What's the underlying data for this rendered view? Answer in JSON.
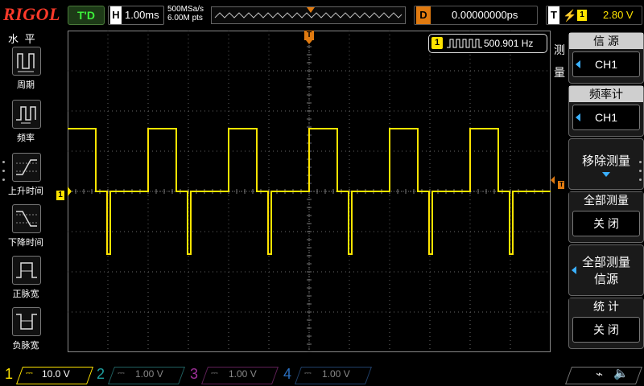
{
  "brand": "RIGOL",
  "top": {
    "trigger_status": "T'D",
    "horizontal_label": "H",
    "timebase": "1.00ms",
    "sample_rate": "500MSa/s",
    "memory_depth": "6.00M pts",
    "delay_label": "D",
    "delay_value": "0.00000000ps",
    "trigger_label": "T",
    "trigger_slope_icon": "rising-edge-icon",
    "trigger_source": "1",
    "trigger_level": "2.80 V"
  },
  "left_toolbar": {
    "title": "水 平",
    "items": [
      {
        "label": "周期",
        "icon": "period-icon"
      },
      {
        "label": "频率",
        "icon": "frequency-icon"
      },
      {
        "label": "上升时间",
        "icon": "rise-time-icon"
      },
      {
        "label": "下降时间",
        "icon": "fall-time-icon"
      },
      {
        "label": "正脉宽",
        "icon": "positive-width-icon"
      },
      {
        "label": "负脉宽",
        "icon": "negative-width-icon"
      }
    ]
  },
  "measurement": {
    "channel": "1",
    "icon": "square-wave-icon",
    "value": "500.901 Hz"
  },
  "right_menu": {
    "side_label_1": "测",
    "side_label_2": "量",
    "source_title": "信 源",
    "source_value": "CH1",
    "freq_counter_title": "频率计",
    "freq_counter_value": "CH1",
    "remove_measure": "移除测量",
    "all_measure_title": "全部测量",
    "all_measure_value": "关 闭",
    "all_measure_source_line1": "全部测量",
    "all_measure_source_line2": "信源",
    "stats_title": "统 计",
    "stats_value": "关 闭"
  },
  "markers": {
    "ch1_ground": "1",
    "trigger_pos": "T"
  },
  "bottom": {
    "channels": [
      {
        "num": "1",
        "scale": "10.0 V",
        "color": "#ffe400",
        "active": true
      },
      {
        "num": "2",
        "scale": "1.00 V",
        "color": "#1fa0a0",
        "active": false
      },
      {
        "num": "3",
        "scale": "1.00 V",
        "color": "#a0309a",
        "active": false
      },
      {
        "num": "4",
        "scale": "1.00 V",
        "color": "#2a6fc0",
        "active": false
      }
    ]
  },
  "waveform": {
    "frequency_hz": 500.901,
    "duty_fraction": 0.35,
    "color": "#ffe400"
  }
}
